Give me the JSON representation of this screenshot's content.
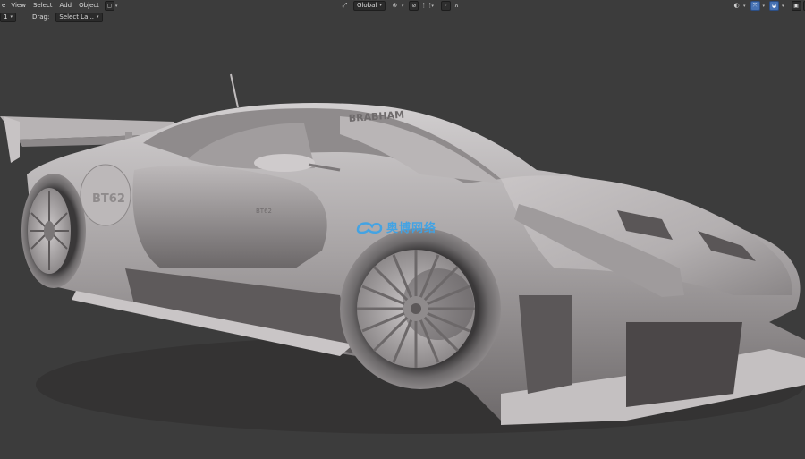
{
  "header": {
    "mode_menu_fragment": "e",
    "menus": [
      "View",
      "Select",
      "Add",
      "Object"
    ],
    "transform_orientation": "Global",
    "icons": [
      "object-mode-icon",
      "pivot-icon",
      "snap-icon",
      "snap-increment-icon",
      "proportional-editing-icon",
      "falloff-icon",
      "visibility-icon",
      "gizmo-icon",
      "overlay-icon",
      "xray-icon",
      "shading-solid-icon"
    ]
  },
  "tool_header": {
    "fragment": "1",
    "drag_label": "Drag:",
    "drag_value": "Select La..."
  },
  "car": {
    "brand_text": "BRABHAM",
    "badge_text": "BT62",
    "side_text": "BT62"
  },
  "watermark": {
    "text": "奥博网络"
  },
  "colors": {
    "viewport_bg": "#3c3c3c",
    "accent": "#4772b3",
    "watermark": "#3fa3e6"
  }
}
